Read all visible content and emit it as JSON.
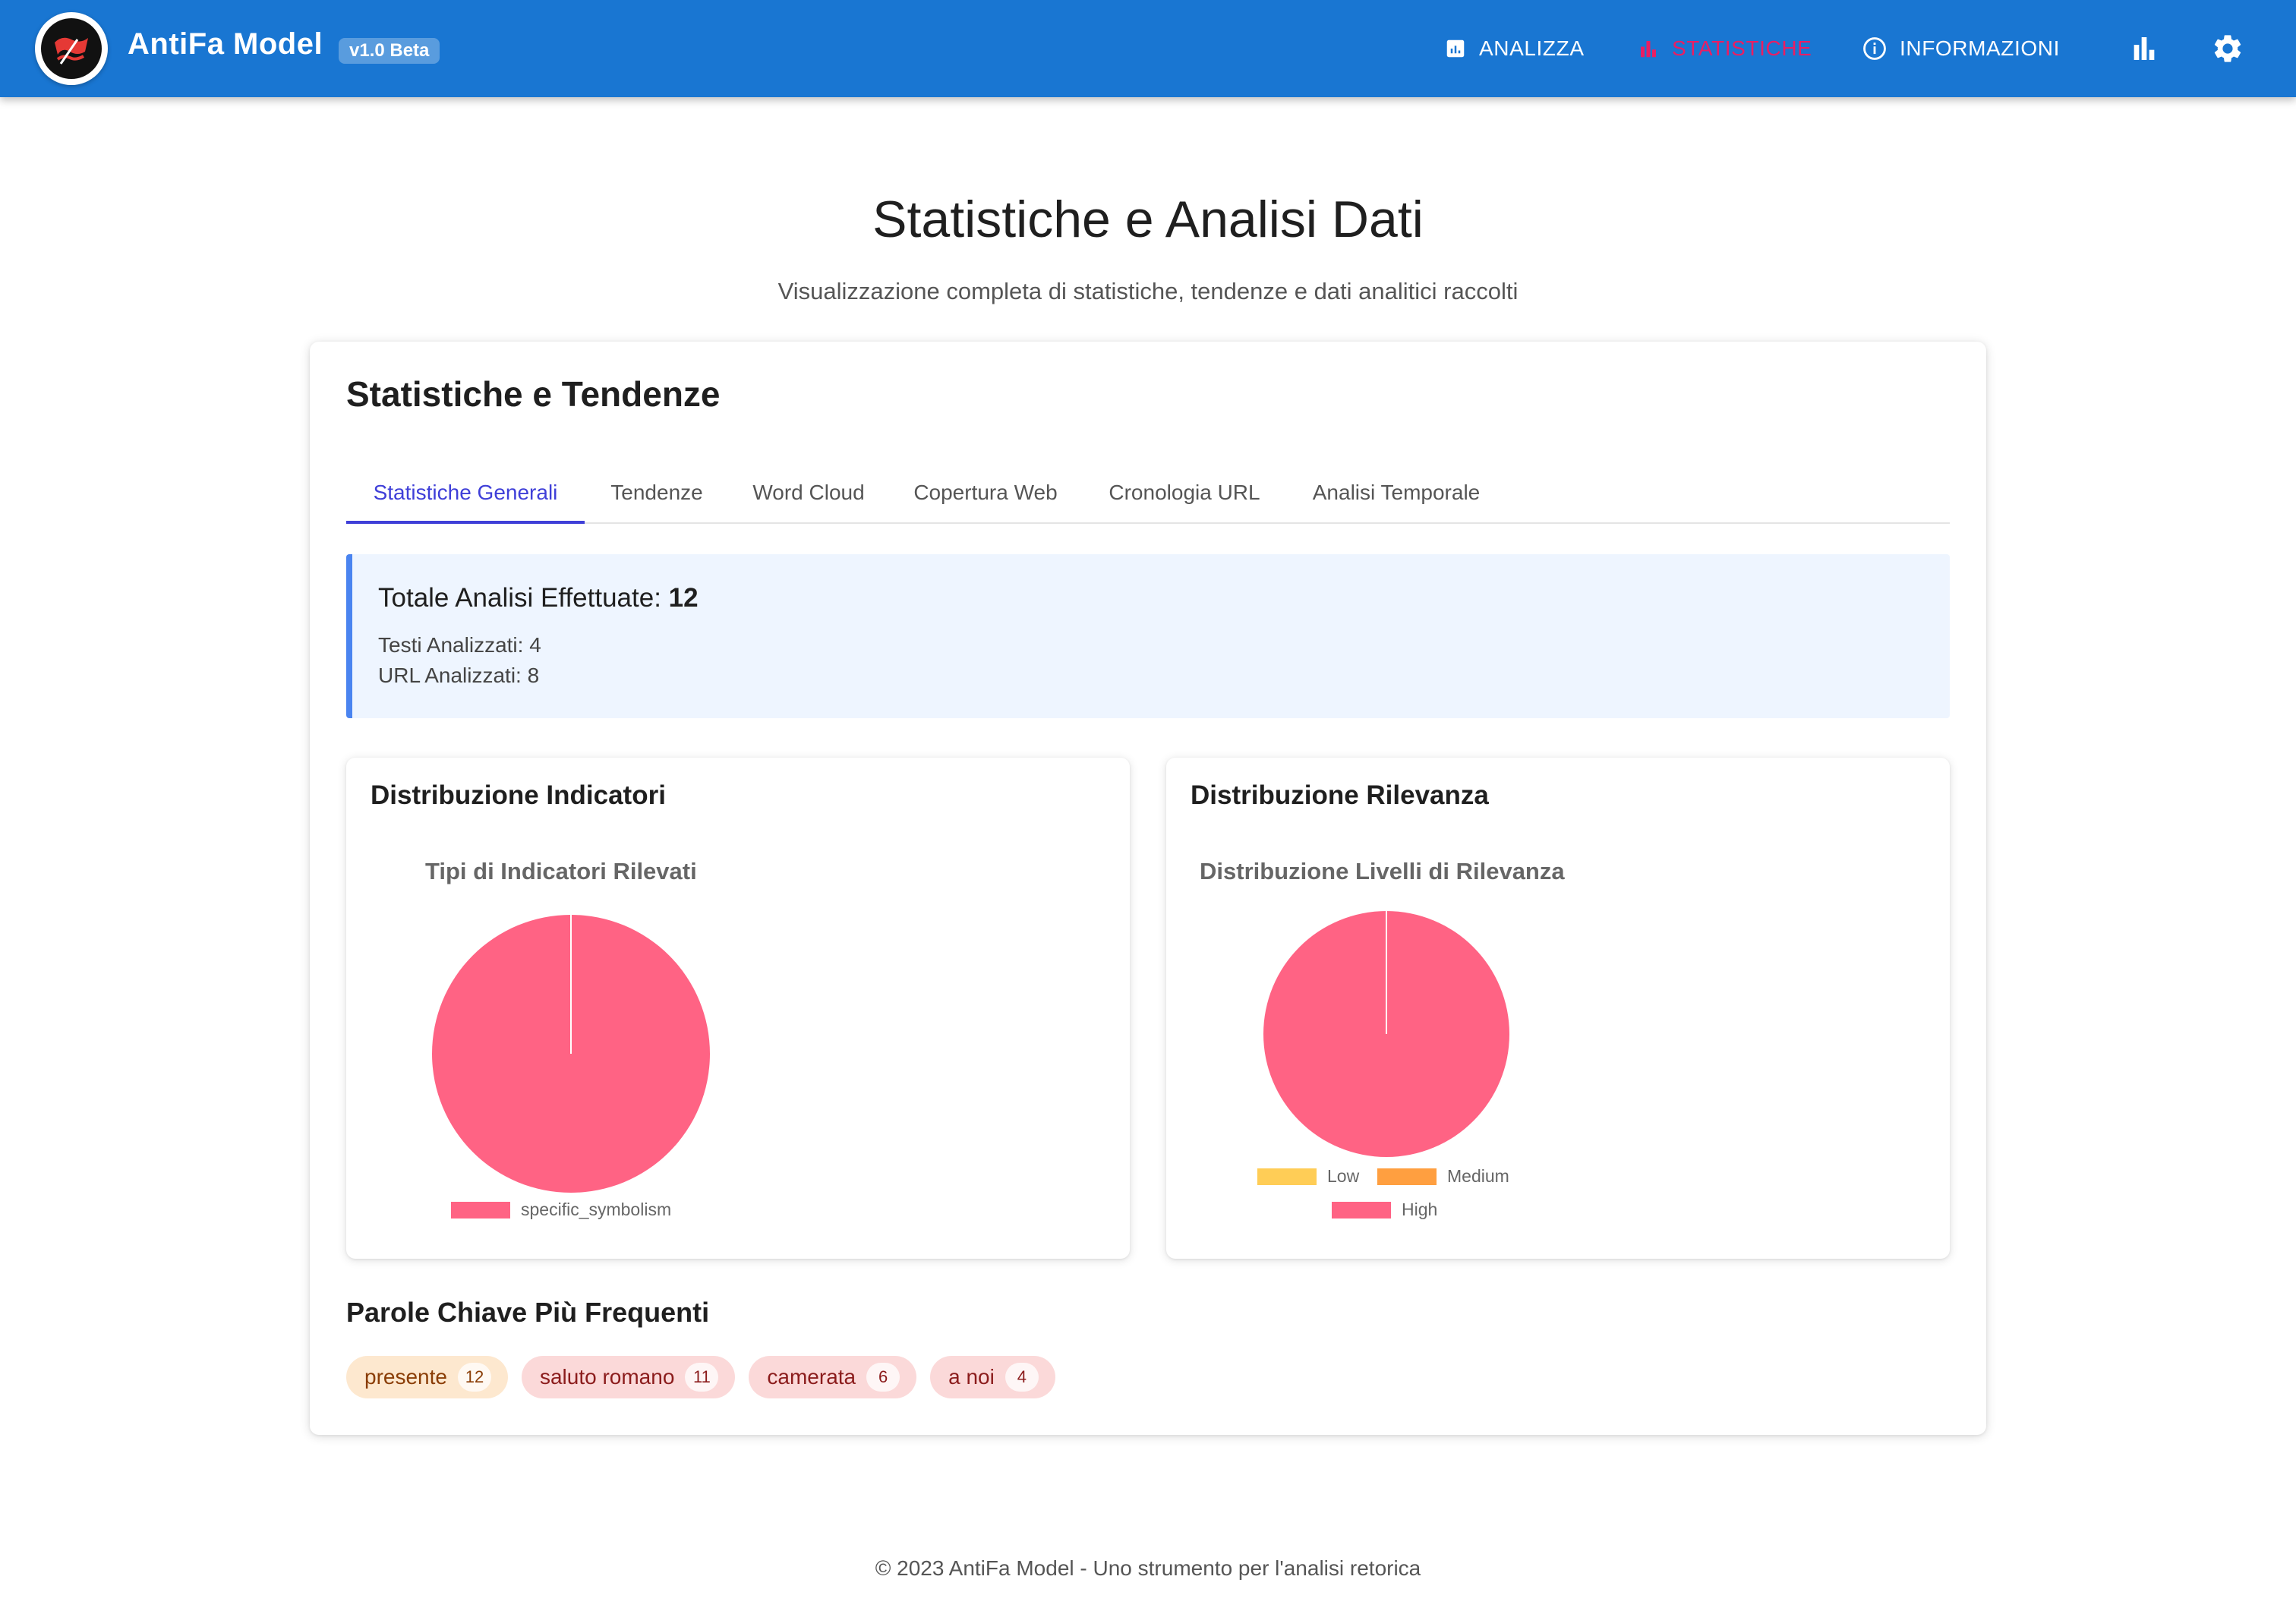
{
  "header": {
    "brand": "AntiFa Model",
    "version": "v1.0 Beta",
    "nav": [
      {
        "label": "ANALIZZA"
      },
      {
        "label": "STATISTICHE"
      },
      {
        "label": "INFORMAZIONI"
      }
    ],
    "accent": "#1976d2",
    "active_color": "#e91e63"
  },
  "page": {
    "title": "Statistiche e Analisi Dati",
    "subtitle": "Visualizzazione completa di statistiche, tendenze e dati analitici raccolti"
  },
  "card": {
    "title": "Statistiche e Tendenze",
    "tabs": [
      {
        "label": "Statistiche Generali"
      },
      {
        "label": "Tendenze"
      },
      {
        "label": "Word Cloud"
      },
      {
        "label": "Copertura Web"
      },
      {
        "label": "Cronologia URL"
      },
      {
        "label": "Analisi Temporale"
      }
    ],
    "summary": {
      "title_label": "Totale Analisi Effettuate:",
      "total": "12",
      "texts": "Testi Analizzati: 4",
      "urls": "URL Analizzati: 8"
    },
    "indicators_panel": {
      "title": "Distribuzione Indicatori",
      "chart_title": "Tipi di Indicatori Rilevati"
    },
    "relevance_panel": {
      "title": "Distribuzione Rilevanza",
      "chart_title": "Distribuzione Livelli di Rilevanza"
    },
    "keywords": {
      "title": "Parole Chiave Più Frequenti",
      "items": [
        {
          "word": "presente",
          "count": "12"
        },
        {
          "word": "saluto romano",
          "count": "11"
        },
        {
          "word": "camerata",
          "count": "6"
        },
        {
          "word": "a noi",
          "count": "4"
        }
      ]
    }
  },
  "chart_data": [
    {
      "type": "pie",
      "title": "Tipi di Indicatori Rilevati",
      "categories": [
        "specific_symbolism"
      ],
      "values": [
        1
      ],
      "colors": [
        "#ff6384"
      ],
      "legend": "bottom"
    },
    {
      "type": "pie",
      "title": "Distribuzione Livelli di Rilevanza",
      "categories": [
        "Low",
        "Medium",
        "High"
      ],
      "values": [
        0,
        0,
        1
      ],
      "colors": [
        "#ffcd56",
        "#ff9f40",
        "#ff6384"
      ],
      "legend": "bottom"
    }
  ],
  "footer": "© 2023 AntiFa Model - Uno strumento per l'analisi retorica"
}
